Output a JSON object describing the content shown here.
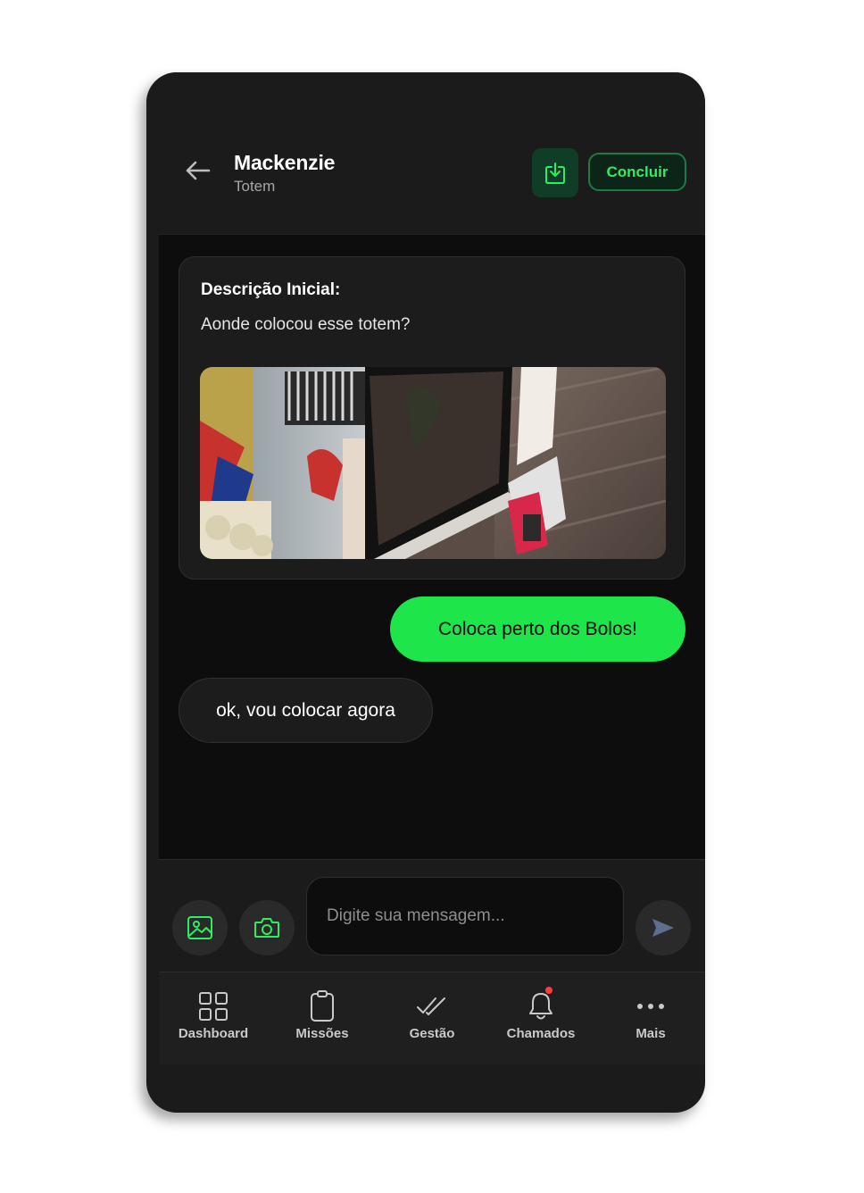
{
  "header": {
    "title": "Mackenzie",
    "subtitle": "Totem",
    "concluir_label": "Concluir"
  },
  "chat": {
    "description_label": "Descrição Inicial:",
    "description_text": "Aonde colocou esse totem?",
    "messages": [
      {
        "direction": "outgoing",
        "text": "Coloca perto dos Bolos!"
      },
      {
        "direction": "incoming",
        "text": "ok, vou colocar agora"
      }
    ]
  },
  "composer": {
    "placeholder": "Digite sua mensagem..."
  },
  "nav": {
    "items": [
      {
        "label": "Dashboard",
        "icon": "grid-icon"
      },
      {
        "label": "Missões",
        "icon": "clipboard-icon"
      },
      {
        "label": "Gestão",
        "icon": "double-check-icon"
      },
      {
        "label": "Chamados",
        "icon": "bell-icon"
      },
      {
        "label": "Mais",
        "icon": "more-icon"
      }
    ]
  },
  "colors": {
    "accent_green": "#1ee64a",
    "background": "#0d0d0d",
    "surface": "#1b1b1b",
    "notification": "#ff3b3b"
  }
}
